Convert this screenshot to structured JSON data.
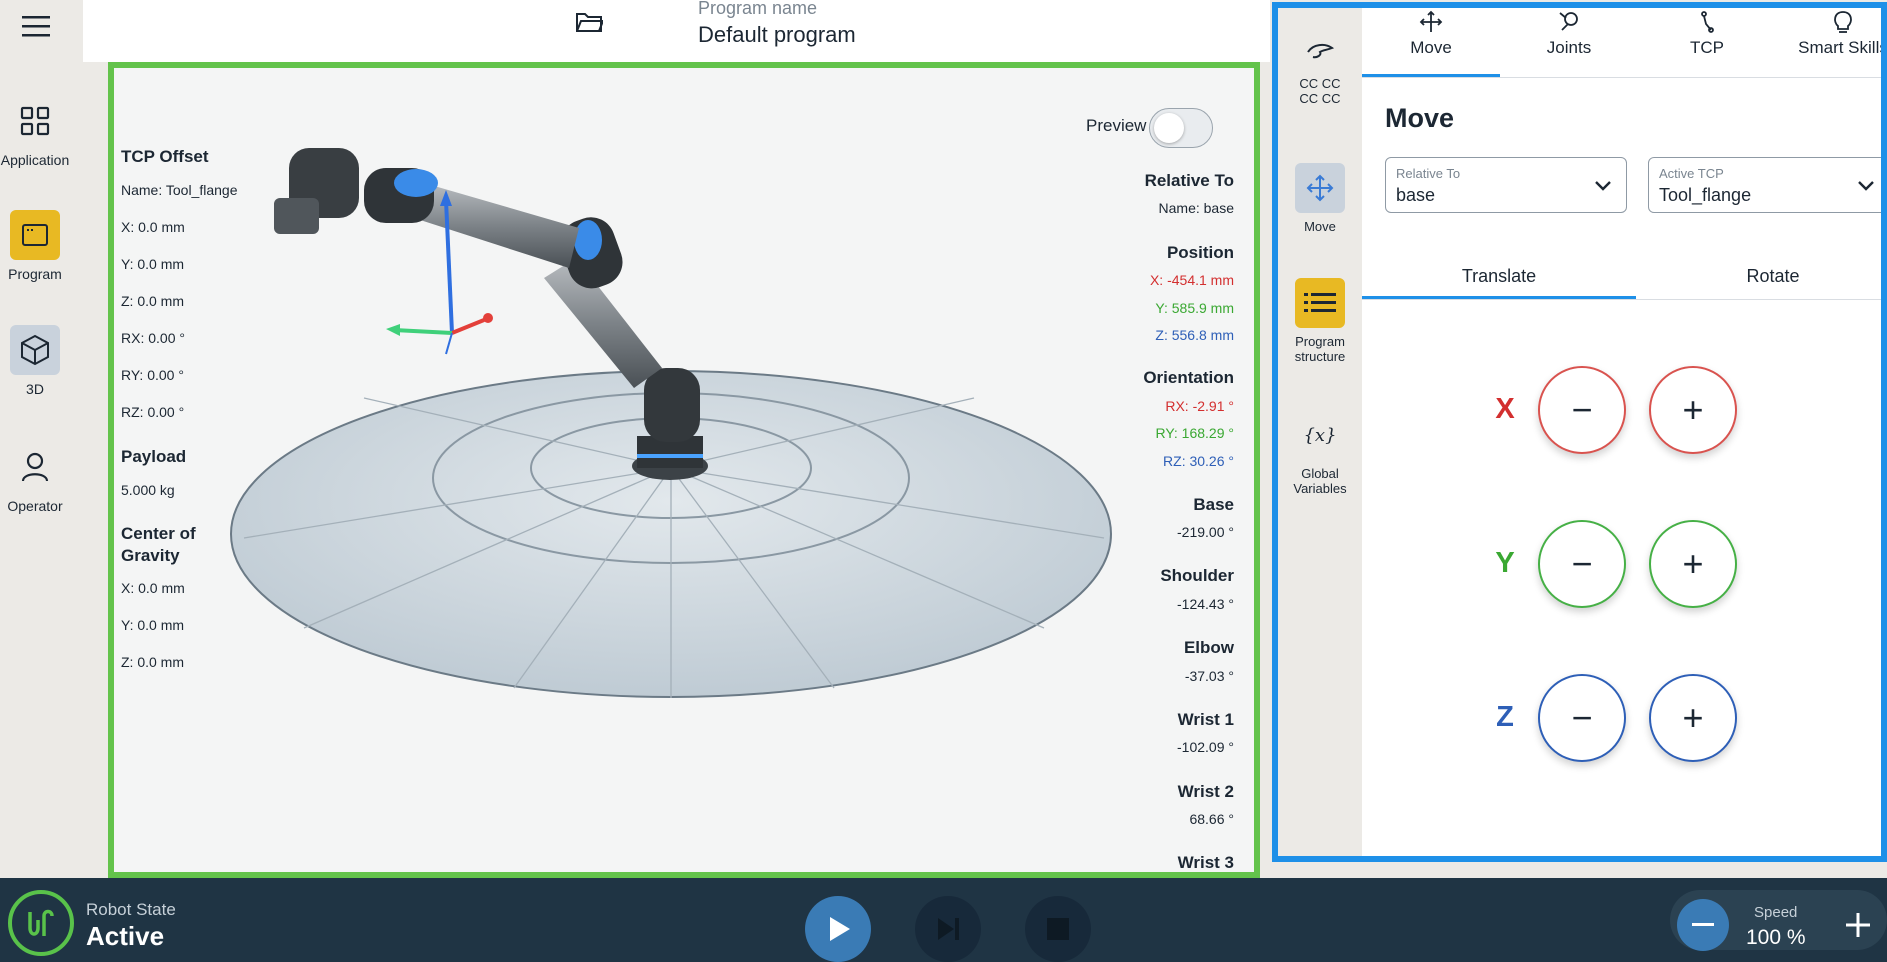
{
  "nav": {
    "items": [
      {
        "label": "Application",
        "icon": "grid-icon"
      },
      {
        "label": "Program",
        "icon": "program-icon"
      },
      {
        "label": "3D",
        "icon": "cube-icon"
      },
      {
        "label": "Operator",
        "icon": "person-icon"
      }
    ]
  },
  "header": {
    "program_label": "Program name",
    "program_title": "Default program"
  },
  "viewport": {
    "preview_label": "Preview",
    "preview_on": false,
    "tcp_offset": {
      "heading": "TCP Offset",
      "name": "Name: Tool_flange",
      "x": "X: 0.0 mm",
      "y": "Y: 0.0 mm",
      "z": "Z: 0.0 mm",
      "rx": "RX: 0.00 °",
      "ry": "RY: 0.00 °",
      "rz": "RZ: 0.00 °"
    },
    "payload": {
      "heading": "Payload",
      "value": "5.000 kg"
    },
    "cog": {
      "heading_1": "Center of",
      "heading_2": "Gravity",
      "x": "X: 0.0 mm",
      "y": "Y: 0.0 mm",
      "z": "Z: 0.0 mm"
    },
    "relative_to": {
      "heading": "Relative To",
      "name": "Name: base"
    },
    "position": {
      "heading": "Position",
      "x": "X: -454.1 mm",
      "y": "Y: 585.9 mm",
      "z": "Z: 556.8 mm"
    },
    "orientation": {
      "heading": "Orientation",
      "rx": "RX: -2.91 °",
      "ry": "RY: 168.29 °",
      "rz": "RZ: 30.26 °"
    },
    "joints": [
      {
        "name": "Base",
        "value": "-219.00 °"
      },
      {
        "name": "Shoulder",
        "value": "-124.43 °"
      },
      {
        "name": "Elbow",
        "value": "-37.03 °"
      },
      {
        "name": "Wrist 1",
        "value": "-102.09 °"
      },
      {
        "name": "Wrist 2",
        "value": "68.66 °"
      },
      {
        "name": "Wrist 3",
        "value": ""
      }
    ]
  },
  "right_panel": {
    "rail": [
      {
        "label_1": "CC CC",
        "label_2": "CC CC",
        "icon": "hand-icon"
      },
      {
        "label_1": "Move",
        "label_2": "",
        "icon": "move-icon"
      },
      {
        "label_1": "Program",
        "label_2": "structure",
        "icon": "list-icon"
      },
      {
        "label_1": "Global",
        "label_2": "Variables",
        "icon": "variables-icon"
      }
    ],
    "tabs": [
      {
        "label": "Move",
        "icon": "move-arrows-icon"
      },
      {
        "label": "Joints",
        "icon": "joints-icon"
      },
      {
        "label": "TCP",
        "icon": "tcp-icon"
      },
      {
        "label": "Smart Skills",
        "icon": "lightbulb-icon"
      }
    ],
    "title": "Move",
    "relative_to": {
      "label": "Relative To",
      "value": "base"
    },
    "active_tcp": {
      "label": "Active TCP",
      "value": "Tool_flange"
    },
    "subtabs": {
      "translate": "Translate",
      "rotate": "Rotate"
    },
    "axes": [
      {
        "letter": "X",
        "color": "#d32f2f"
      },
      {
        "letter": "Y",
        "color": "#3aa832"
      },
      {
        "letter": "Z",
        "color": "#2e5fb7"
      }
    ],
    "minus_glyph": "−",
    "plus_glyph": "+"
  },
  "bottom": {
    "state_label": "Robot State",
    "state_value": "Active",
    "speed_label": "Speed",
    "speed_value": "100 %"
  },
  "colors": {
    "accent_blue": "#1e90e8",
    "viewport_border": "#63c34b",
    "program_yellow": "#e8b923",
    "bottom_bar": "#1f3444"
  }
}
